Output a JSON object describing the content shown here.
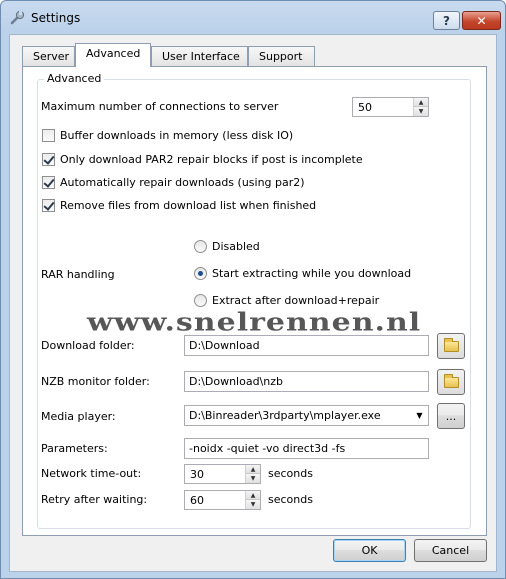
{
  "window": {
    "title": "Settings",
    "help_label": "?",
    "close_label": "✕"
  },
  "tabs": [
    {
      "label": "Server"
    },
    {
      "label": "Advanced"
    },
    {
      "label": "User Interface"
    },
    {
      "label": "Support"
    }
  ],
  "advanced": {
    "group_title": "Advanced",
    "max_connections_label": "Maximum number of connections to server",
    "max_connections_value": "50",
    "checkboxes": [
      {
        "label": "Buffer downloads in memory (less disk IO)",
        "checked": false
      },
      {
        "label": "Only download PAR2 repair blocks if post is incomplete",
        "checked": true
      },
      {
        "label": "Automatically repair downloads (using par2)",
        "checked": true
      },
      {
        "label": "Remove files from download list when finished",
        "checked": true
      }
    ],
    "rar_label": "RAR handling",
    "rar_options": [
      {
        "label": "Disabled",
        "checked": false
      },
      {
        "label": "Start extracting while you download",
        "checked": true
      },
      {
        "label": "Extract after download+repair",
        "checked": false
      }
    ],
    "download_folder_label": "Download folder:",
    "download_folder_value": "D:\\Download",
    "nzb_folder_label": "NZB monitor folder:",
    "nzb_folder_value": "D:\\Download\\nzb",
    "media_player_label": "Media player:",
    "media_player_value": "D:\\Binreader\\3rdparty\\mplayer.exe",
    "media_browse_label": "...",
    "parameters_label": "Parameters:",
    "parameters_value": "-noidx -quiet -vo direct3d -fs",
    "timeout_label": "Network time-out:",
    "timeout_value": "30",
    "timeout_unit": "seconds",
    "retry_label": "Retry after waiting:",
    "retry_value": "60",
    "retry_unit": "seconds"
  },
  "footer": {
    "ok_label": "OK",
    "cancel_label": "Cancel"
  },
  "watermark": "www.snelrennen.nl"
}
